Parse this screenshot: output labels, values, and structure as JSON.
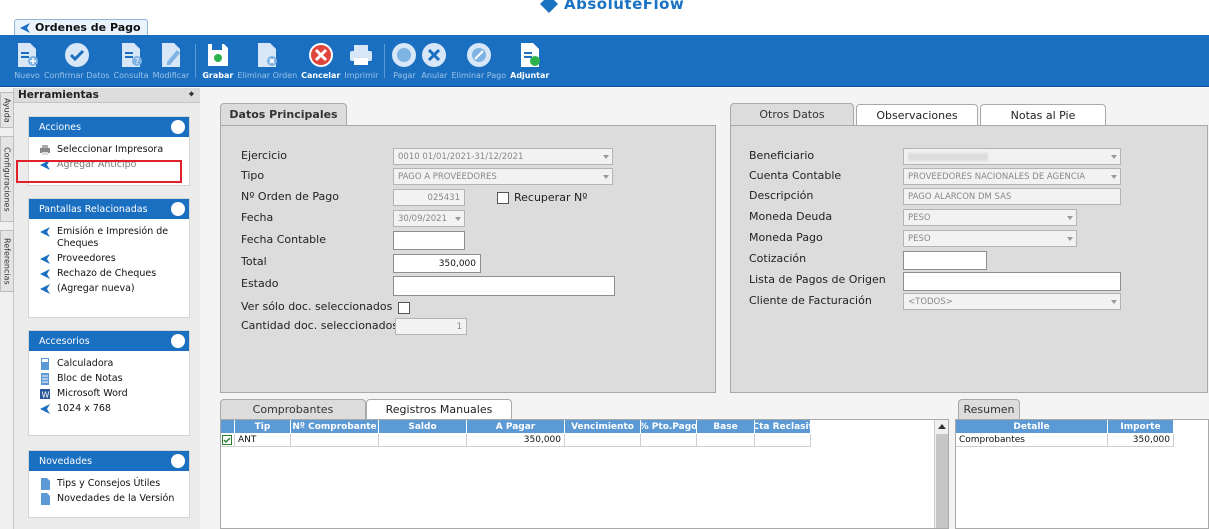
{
  "brand": {
    "logo_text": "AbsoluteFlow"
  },
  "window_tab": {
    "label": "Ordenes de Pago"
  },
  "toolbar": {
    "buttons": [
      {
        "id": "nuevo",
        "label": "Nuevo",
        "icon": "new-doc-icon",
        "enabled": false
      },
      {
        "id": "confirmar",
        "label": "Confirmar Datos",
        "icon": "check-icon",
        "enabled": false
      },
      {
        "id": "consulta",
        "label": "Consulta",
        "icon": "query-doc-icon",
        "enabled": false
      },
      {
        "id": "modificar",
        "label": "Modificar",
        "icon": "edit-doc-icon",
        "enabled": false
      },
      {
        "id": "grabar",
        "label": "Grabar",
        "icon": "save-icon",
        "enabled": true
      },
      {
        "id": "eliminar_orden",
        "label": "Eliminar Orden",
        "icon": "delete-doc-icon",
        "enabled": false
      },
      {
        "id": "cancelar",
        "label": "Cancelar",
        "icon": "cancel-icon",
        "enabled": true
      },
      {
        "id": "imprimir",
        "label": "Imprimir",
        "icon": "printer-icon",
        "enabled": false
      },
      {
        "id": "pagar",
        "label": "Pagar",
        "icon": "pay-icon",
        "enabled": false
      },
      {
        "id": "anular",
        "label": "Anular",
        "icon": "void-icon",
        "enabled": false
      },
      {
        "id": "eliminar_pago",
        "label": "Eliminar Pago",
        "icon": "delete-pay-icon",
        "enabled": false
      },
      {
        "id": "adjuntar",
        "label": "Adjuntar",
        "icon": "attach-icon",
        "enabled": true
      }
    ]
  },
  "rail": {
    "tabs": [
      "Ayuda",
      "Configuraciones",
      "Referencias"
    ]
  },
  "side_panel": {
    "title": "Herramientas",
    "pin_glyph": "⌖",
    "groups": [
      {
        "title": "Acciones",
        "items": [
          {
            "label": "Seleccionar Impresora",
            "icon": "printer-icon",
            "disabled": false
          },
          {
            "label": "Agregar Anticipo",
            "icon": "arrow-icon",
            "disabled": true
          }
        ]
      },
      {
        "title": "Pantallas Relacionadas",
        "items": [
          {
            "label": "Emisión e Impresión de Cheques",
            "icon": "arrow-icon",
            "disabled": false
          },
          {
            "label": "Proveedores",
            "icon": "arrow-icon",
            "disabled": false
          },
          {
            "label": "Rechazo de Cheques",
            "icon": "arrow-icon",
            "disabled": false
          },
          {
            "label": "(Agregar nueva)",
            "icon": "arrow-icon",
            "disabled": false
          }
        ]
      },
      {
        "title": "Accesorios",
        "items": [
          {
            "label": "Calculadora",
            "icon": "calculator-icon",
            "disabled": false
          },
          {
            "label": "Bloc de Notas",
            "icon": "notepad-icon",
            "disabled": false
          },
          {
            "label": "Microsoft Word",
            "icon": "word-icon",
            "disabled": false
          },
          {
            "label": "1024 x 768",
            "icon": "arrow-icon",
            "disabled": false
          }
        ]
      },
      {
        "title": "Novedades",
        "items": [
          {
            "label": "Tips y Consejos Útiles",
            "icon": "document-icon",
            "disabled": false
          },
          {
            "label": "Novedades de la Versión",
            "icon": "document-icon",
            "disabled": false
          }
        ]
      }
    ]
  },
  "datos_principales": {
    "tab": "Datos Principales",
    "ejercicio": {
      "label": "Ejercicio",
      "value": "0010 01/01/2021-31/12/2021"
    },
    "tipo": {
      "label": "Tipo",
      "value": "PAGO A PROVEEDORES"
    },
    "nro_orden": {
      "label": "Nº Orden de Pago",
      "value": "025431"
    },
    "recuperar": {
      "label": "Recuperar Nº"
    },
    "fecha": {
      "label": "Fecha",
      "value": "30/09/2021"
    },
    "fecha_contable": {
      "label": "Fecha Contable",
      "value": ""
    },
    "total": {
      "label": "Total",
      "value": "350,000"
    },
    "estado": {
      "label": "Estado",
      "value": ""
    },
    "ver_solo": {
      "label": "Ver sólo doc. seleccionados"
    },
    "cantidad": {
      "label": "Cantidad doc. seleccionados",
      "value": "1"
    }
  },
  "otros_datos": {
    "tabs": [
      "Otros Datos",
      "Observaciones",
      "Notas al Pie"
    ],
    "beneficiario": {
      "label": "Beneficiario",
      "value": ""
    },
    "cuenta_contable": {
      "label": "Cuenta Contable",
      "value": "PROVEEDORES NACIONALES DE AGENCIA"
    },
    "descripcion": {
      "label": "Descripción",
      "value": "PAGO ALARCON DM SAS"
    },
    "moneda_deuda": {
      "label": "Moneda Deuda",
      "value": "PESO"
    },
    "moneda_pago": {
      "label": "Moneda Pago",
      "value": "PESO"
    },
    "cotizacion": {
      "label": "Cotización",
      "value": ""
    },
    "lista_pagos": {
      "label": "Lista de Pagos de Origen",
      "value": ""
    },
    "cliente_fact": {
      "label": "Cliente de Facturación",
      "value": "<TODOS>"
    }
  },
  "comprobantes": {
    "tabs": [
      "Comprobantes",
      "Registros Manuales"
    ],
    "columns": [
      "Tip",
      "Nº Comprobante",
      "Saldo",
      "A Pagar",
      "Vencimiento",
      "% Pto.Pago",
      "Base",
      "Cta Reclasif"
    ],
    "rows": [
      {
        "checked": true,
        "tip": "ANT",
        "nro": "",
        "saldo": "",
        "a_pagar": "350,000",
        "vencimiento": "",
        "pto_pago": "",
        "base": "",
        "cta": ""
      }
    ]
  },
  "resumen": {
    "tab": "Resumen",
    "columns": [
      "Detalle",
      "Importe"
    ],
    "rows": [
      {
        "detalle": "Comprobantes",
        "importe": "350,000"
      }
    ]
  },
  "colors": {
    "brand_blue": "#1a6fc0",
    "header_blue": "#5b9ad4",
    "highlight_red": "#e0202a"
  }
}
